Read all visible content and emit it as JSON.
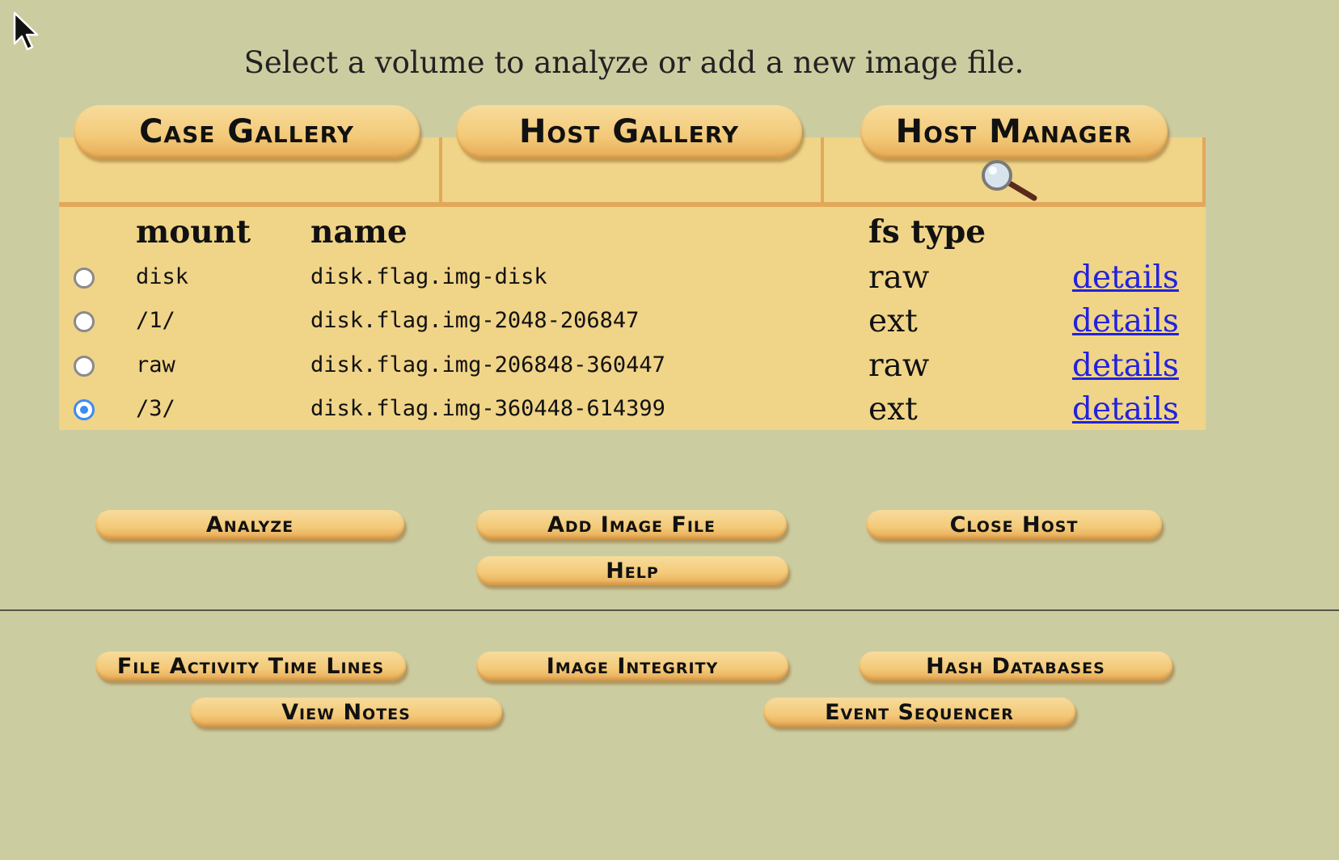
{
  "instruction": "Select a volume to analyze or add a new image file.",
  "tabs": {
    "case_gallery": "Case Gallery",
    "host_gallery": "Host Gallery",
    "host_manager": "Host Manager"
  },
  "table": {
    "headers": {
      "mount": "mount",
      "name": "name",
      "fs_type": "fs type"
    },
    "rows": [
      {
        "mount": "disk",
        "name": "disk.flag.img-disk",
        "fs_type": "raw",
        "link": "details",
        "selected": false
      },
      {
        "mount": "/1/",
        "name": "disk.flag.img-2048-206847",
        "fs_type": "ext",
        "link": "details",
        "selected": false
      },
      {
        "mount": "raw",
        "name": "disk.flag.img-206848-360447",
        "fs_type": "raw",
        "link": "details",
        "selected": false
      },
      {
        "mount": "/3/",
        "name": "disk.flag.img-360448-614399",
        "fs_type": "ext",
        "link": "details",
        "selected": true
      }
    ]
  },
  "actions": {
    "analyze": "Analyze",
    "add_image_file": "Add Image File",
    "close_host": "Close Host",
    "help": "Help"
  },
  "tools": {
    "file_activity_time_lines": "File Activity Time Lines",
    "image_integrity": "Image Integrity",
    "hash_databases": "Hash Databases",
    "view_notes": "View Notes",
    "event_sequencer": "Event Sequencer"
  },
  "colors": {
    "background": "#cccca1",
    "panel": "#f0d488",
    "button": "#f3c978",
    "link": "#2222dd",
    "radio_selected": "#3d8bf0"
  }
}
